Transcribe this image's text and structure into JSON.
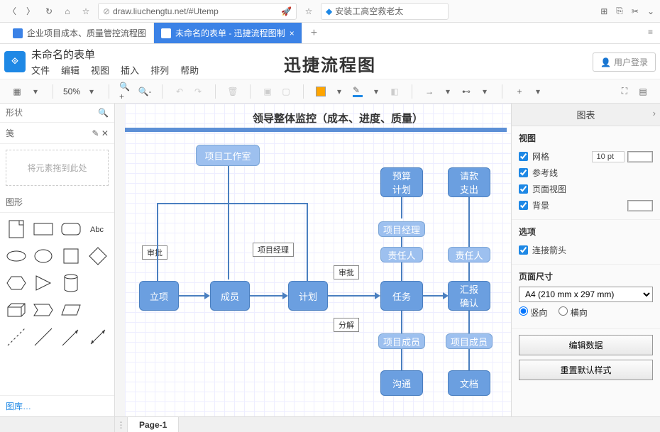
{
  "browser": {
    "url": "draw.liuchengtu.net/#Utemp",
    "search_placeholder": "安装工高空救老太"
  },
  "tabs": [
    {
      "label": "企业项目成本、质量管控流程图",
      "active": false
    },
    {
      "label": "未命名的表单 - 迅捷流程图制",
      "active": true
    }
  ],
  "app": {
    "doc_title": "未命名的表单",
    "center_title": "迅捷流程图",
    "user_login": "用户登录"
  },
  "menu": [
    "文件",
    "编辑",
    "视图",
    "插入",
    "排列",
    "帮助"
  ],
  "toolbar": {
    "zoom": "50%"
  },
  "sidebar": {
    "search_placeholder": "形状",
    "scratch_label": "笺",
    "dropzone": "将元素拖到此处",
    "shapes_label": "图形",
    "lib_footer": "图库…"
  },
  "canvas": {
    "title": "领导整体监控（成本、进度、质量）",
    "nodes": {
      "workroom": "项目工作室",
      "budget": "预算\n计划",
      "payment": "请款\n支出",
      "pm1": "项目经理",
      "pm2": "项目经理",
      "resp1": "责任人",
      "resp2": "责任人",
      "establish": "立项",
      "members": "成员",
      "plan": "计划",
      "task": "任务",
      "report": "汇报\n确认",
      "member_list1": "项目成员",
      "member_list2": "项目成员",
      "comm": "沟通",
      "doc": "文档"
    },
    "labels": {
      "approve1": "审批",
      "approve2": "审批",
      "decompose": "分解"
    }
  },
  "right_panel": {
    "header": "图表",
    "view_section": "视图",
    "grid": "网格",
    "grid_val": "10 pt",
    "guides": "参考线",
    "page_view": "页面视图",
    "background": "背景",
    "options_section": "选项",
    "connect_arrow": "连接箭头",
    "page_size_section": "页面尺寸",
    "page_size_val": "A4 (210 mm x 297 mm)",
    "portrait": "竖向",
    "landscape": "横向",
    "edit_data": "编辑数据",
    "reset_style": "重置默认样式"
  },
  "page_tab": "Page-1"
}
